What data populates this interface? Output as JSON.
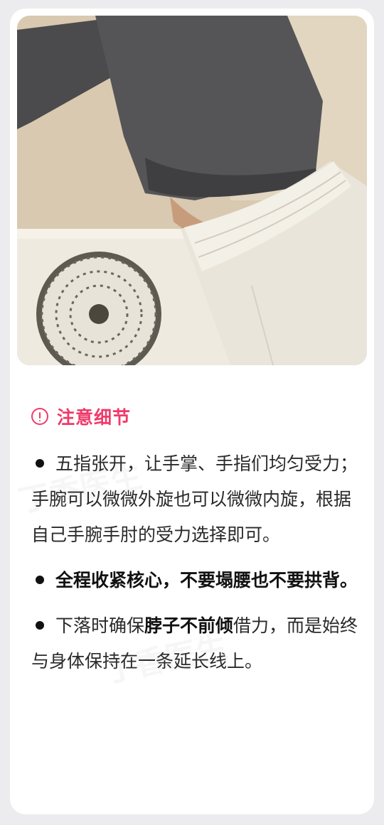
{
  "notice": {
    "icon": "exclamation-circle-icon",
    "title": "注意细节",
    "color": "#ef3a6a"
  },
  "tips": [
    {
      "text": "五指张开，让手掌、手指们均匀受力；手腕可以微微外旋也可以微微内旋，根据自己手腕手肘的受力选择即可。"
    },
    {
      "text": "全程收紧核心，不要塌腰也不要拱背。"
    },
    {
      "before": "下落时确保",
      "bold": "脖子不前倾",
      "after": "借力，而是始终与身体保持在一条延长线上。"
    }
  ],
  "watermark": "丁香医生"
}
